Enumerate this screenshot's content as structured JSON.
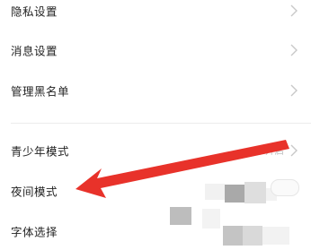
{
  "settings": {
    "items": [
      {
        "label": "隐私设置",
        "status": ""
      },
      {
        "label": "消息设置",
        "status": ""
      },
      {
        "label": "管理黑名单",
        "status": ""
      },
      {
        "label": "青少年模式",
        "status": "未开启"
      },
      {
        "label": "夜间模式",
        "status": ""
      },
      {
        "label": "字体选择",
        "status": ""
      }
    ]
  },
  "colors": {
    "text": "#222222",
    "chevron": "#c8c8c8",
    "status": "#bdbdbd",
    "divider": "#ececec",
    "annotation_arrow": "#e8322a"
  },
  "icons": {
    "row_chevron": "chevron-right-icon",
    "annotation": "red-arrow-icon"
  }
}
